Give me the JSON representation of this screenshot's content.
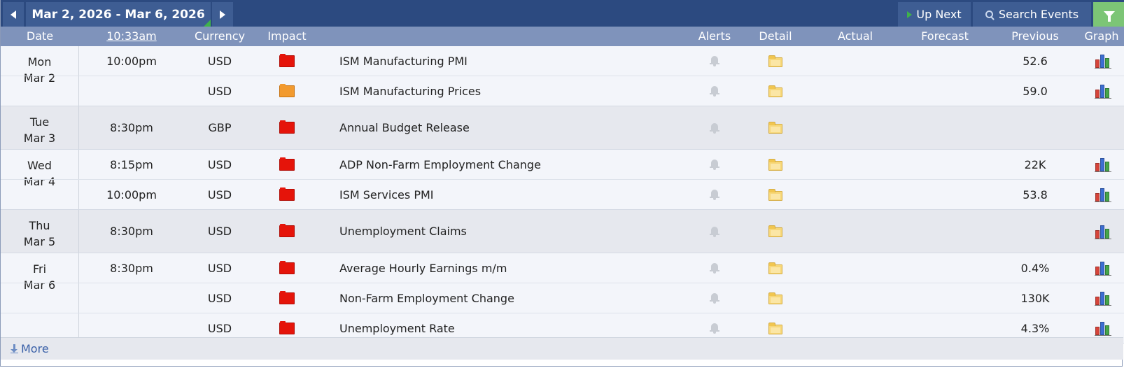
{
  "toolbar": {
    "date_range": "Mar 2, 2026 - Mar 6, 2026",
    "up_next_label": "Up Next",
    "search_events_label": "Search Events"
  },
  "columns": {
    "date": "Date",
    "time": "10:33am",
    "currency": "Currency",
    "impact": "Impact",
    "alerts": "Alerts",
    "detail": "Detail",
    "actual": "Actual",
    "forecast": "Forecast",
    "previous": "Previous",
    "graph": "Graph"
  },
  "days": [
    {
      "weekday": "Mon",
      "date": "Mar 2",
      "events": [
        {
          "time": "10:00pm",
          "currency": "USD",
          "impact": "high",
          "event": "ISM Manufacturing PMI",
          "actual": "",
          "forecast": "",
          "previous": "52.6",
          "graph": true
        },
        {
          "time": "",
          "currency": "USD",
          "impact": "medium",
          "event": "ISM Manufacturing Prices",
          "actual": "",
          "forecast": "",
          "previous": "59.0",
          "graph": true
        }
      ]
    },
    {
      "weekday": "Tue",
      "date": "Mar 3",
      "events": [
        {
          "time": "8:30pm",
          "currency": "GBP",
          "impact": "high",
          "event": "Annual Budget Release",
          "actual": "",
          "forecast": "",
          "previous": "",
          "graph": false
        }
      ]
    },
    {
      "weekday": "Wed",
      "date": "Mar 4",
      "events": [
        {
          "time": "8:15pm",
          "currency": "USD",
          "impact": "high",
          "event": "ADP Non-Farm Employment Change",
          "actual": "",
          "forecast": "",
          "previous": "22K",
          "graph": true
        },
        {
          "time": "10:00pm",
          "currency": "USD",
          "impact": "high",
          "event": "ISM Services PMI",
          "actual": "",
          "forecast": "",
          "previous": "53.8",
          "graph": true
        }
      ]
    },
    {
      "weekday": "Thu",
      "date": "Mar 5",
      "events": [
        {
          "time": "8:30pm",
          "currency": "USD",
          "impact": "high",
          "event": "Unemployment Claims",
          "actual": "",
          "forecast": "",
          "previous": "",
          "graph": true
        }
      ]
    },
    {
      "weekday": "Fri",
      "date": "Mar 6",
      "events": [
        {
          "time": "8:30pm",
          "currency": "USD",
          "impact": "high",
          "event": "Average Hourly Earnings m/m",
          "actual": "",
          "forecast": "",
          "previous": "0.4%",
          "graph": true
        },
        {
          "time": "",
          "currency": "USD",
          "impact": "high",
          "event": "Non-Farm Employment Change",
          "actual": "",
          "forecast": "",
          "previous": "130K",
          "graph": true
        },
        {
          "time": "",
          "currency": "USD",
          "impact": "high",
          "event": "Unemployment Rate",
          "actual": "",
          "forecast": "",
          "previous": "4.3%",
          "graph": true
        }
      ]
    }
  ],
  "footer": {
    "more_label": "More"
  },
  "colors": {
    "topbar": "#2c4a80",
    "header": "#7f93bb",
    "impact_high": "#e5140a",
    "impact_medium": "#f29a2e",
    "filter_button": "#7cc576"
  },
  "icons": {
    "prev": "chevron-left-icon",
    "next": "chevron-right-icon",
    "up_next": "play-icon",
    "search": "search-icon",
    "filter": "filter-icon",
    "impact": "impact-folder-icon",
    "alert": "bell-icon",
    "detail": "folder-icon",
    "graph": "bar-chart-icon",
    "more": "download-arrow-icon"
  }
}
